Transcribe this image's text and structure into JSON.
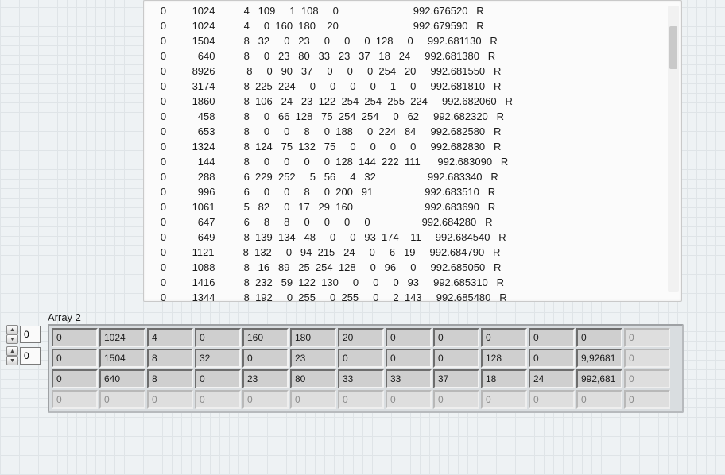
{
  "log_lines": [
    "   0         1024          4   109     1  108     0                          992.676520   R",
    "   0         1024          4     0  160  180    20                          992.679590   R",
    "   0         1504          8   32     0   23     0     0     0  128     0     992.681130   R",
    "   0           640          8     0   23   80   33   23   37   18   24     992.681380   R",
    "   0         8926           8     0   90   37     0     0     0  254   20     992.681550   R",
    "   0         3174          8  225  224     0     0     0     0     1     0     992.681810   R",
    "   0         1860          8  106   24   23  122  254  254  255  224     992.682060   R",
    "   0           458          8     0   66  128   75  254  254     0   62     992.682320   R",
    "   0           653          8     0     0     8     0  188     0  224   84     992.682580   R",
    "   0         1324          8  124   75  132   75     0     0     0     0     992.682830   R",
    "   0           144          8     0     0     0     0  128  144  222  111      992.683090   R",
    "   0           288          6  229  252     5   56     4   32                  992.683340   R",
    "   0           996          6     0     0     8     0  200   91                  992.683510   R",
    "   0         1061          5   82     0   17   29  160                         992.683690   R",
    "   0           647          6     8     8     0     0     0     0                  992.684280   R",
    "   0           649          8  139  134   48     0     0   93  174    11     992.684540   R",
    "   0         1121          8  132     0   94  215   24     0     6   19     992.684790   R",
    "   0         1088          8   16   89   25  254  128     0   96     0     992.685050   R",
    "   0         1416          8  232   59  122  130     0     0     0   93     992.685310   R",
    "   0         1344          8  192     0  255     0  255     0     2  143     992.685480   R"
  ],
  "array_label": "Array 2",
  "index0": "0",
  "index1": "0",
  "array": [
    {
      "enabled": true,
      "cells": [
        "0",
        "1024",
        "4",
        "0",
        "160",
        "180",
        "20",
        "0",
        "0",
        "0",
        "0",
        "0",
        "0"
      ]
    },
    {
      "enabled": true,
      "cells": [
        "0",
        "1504",
        "8",
        "32",
        "0",
        "23",
        "0",
        "0",
        "0",
        "128",
        "0",
        "9,92681",
        "0"
      ]
    },
    {
      "enabled": true,
      "cells": [
        "0",
        "640",
        "8",
        "0",
        "23",
        "80",
        "33",
        "33",
        "37",
        "18",
        "24",
        "992,681",
        "0"
      ]
    },
    {
      "enabled": false,
      "cells": [
        "0",
        "0",
        "0",
        "0",
        "0",
        "0",
        "0",
        "0",
        "0",
        "0",
        "0",
        "0",
        "0"
      ]
    }
  ]
}
